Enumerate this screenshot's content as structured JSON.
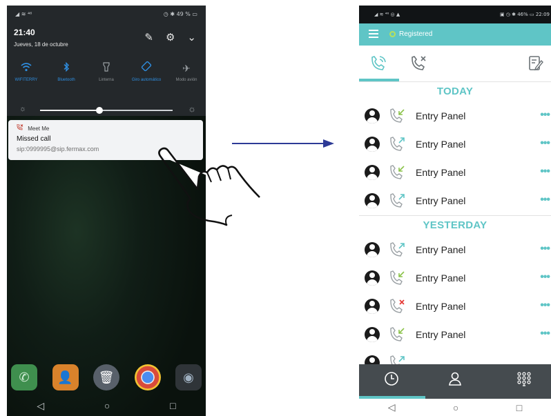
{
  "left_phone": {
    "status": {
      "left": "◢ ≋ ⁴⁶",
      "right": "◷ ✱ 49 % ▭"
    },
    "time": "21:40",
    "date": "Jueves, 18 de octubre",
    "header_icons": [
      "edit-icon",
      "settings-icon",
      "chevron-down-icon"
    ],
    "quick_tiles": [
      {
        "label": "WIFITERRY",
        "icon": "wifi-icon",
        "active": true
      },
      {
        "label": "Bluetooth",
        "icon": "bluetooth-icon",
        "active": true
      },
      {
        "label": "Linterna",
        "icon": "flashlight-icon",
        "active": false
      },
      {
        "label": "Giro automático",
        "icon": "auto-rotate-icon",
        "active": true
      },
      {
        "label": "Modo avión",
        "icon": "airplane-icon",
        "active": false
      }
    ],
    "brightness_level": 0.45,
    "notification": {
      "app": "Meet Me",
      "title": "Missed call",
      "text": "sip:0999995@sip.fermax.com"
    },
    "dock_icons": [
      "phone-icon",
      "contacts-icon",
      "trash-icon",
      "chrome-icon",
      "camera-icon"
    ],
    "nav": [
      "◁",
      "○",
      "□"
    ]
  },
  "right_phone": {
    "status": {
      "left": "◢ ≋ ⁴⁶ ◎ ▲",
      "right": "▣ ◷ ✱ 46% ▭ 22:09"
    },
    "topbar": {
      "status_text": "Registered",
      "status_color": "#b8e05a"
    },
    "tabs": [
      "call-history-icon",
      "missed-calls-icon",
      "notes-icon"
    ],
    "sections": [
      {
        "title": "TODAY",
        "calls": [
          {
            "name": "Entry Panel",
            "type": "incoming"
          },
          {
            "name": "Entry Panel",
            "type": "outgoing"
          },
          {
            "name": "Entry Panel",
            "type": "incoming"
          },
          {
            "name": "Entry Panel",
            "type": "outgoing"
          }
        ]
      },
      {
        "title": "YESTERDAY",
        "calls": [
          {
            "name": "Entry Panel",
            "type": "outgoing"
          },
          {
            "name": "Entry Panel",
            "type": "incoming"
          },
          {
            "name": "Entry Panel",
            "type": "missed"
          },
          {
            "name": "Entry Panel",
            "type": "incoming"
          }
        ]
      }
    ],
    "more_label": "•••",
    "bottom_nav": [
      "history-icon",
      "contacts-icon",
      "dialpad-icon"
    ],
    "nav": [
      "◁",
      "○",
      "□"
    ]
  },
  "colors": {
    "accent": "#5fc5c6",
    "tile_active": "#2f8ee0",
    "incoming": "#8bc34a",
    "outgoing": "#5fc5c6",
    "missed": "#e53935"
  }
}
